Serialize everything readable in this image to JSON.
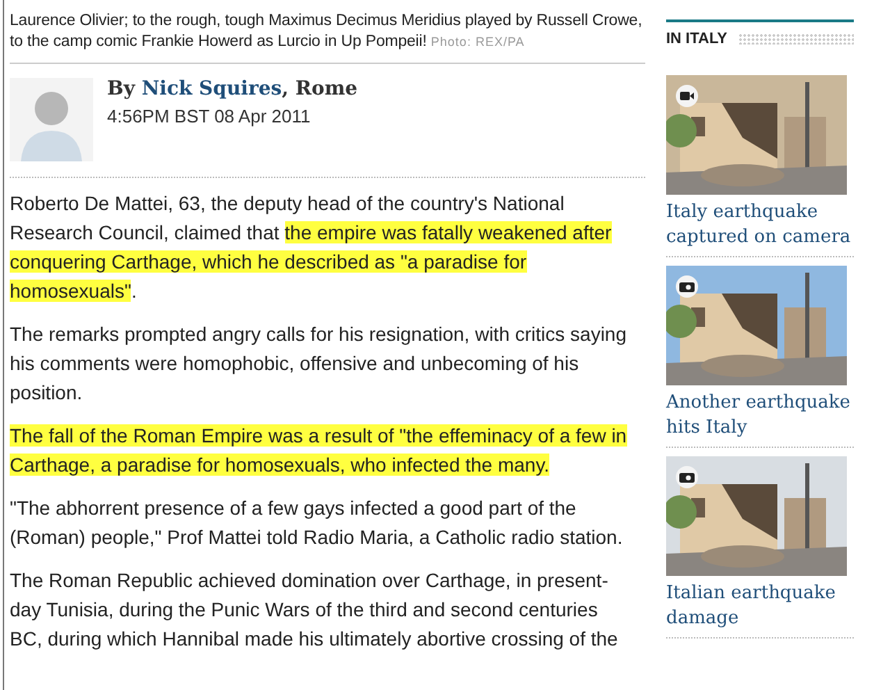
{
  "caption": {
    "text": "Laurence Olivier; to the rough, tough Maximus Decimus Meridius played by Russell Crowe, to the camp comic Frankie Howerd as Lurcio in Up Pompeii!",
    "credit": "Photo: REX/PA"
  },
  "byline": {
    "prefix": "By",
    "author": "Nick Squires",
    "place": ", Rome",
    "date": "4:56PM BST 08 Apr 2011"
  },
  "paragraphs": [
    {
      "segments": [
        {
          "text": "Roberto De Mattei, 63, the deputy head of the country's National Research Council, claimed that ",
          "highlighted": false
        },
        {
          "text": "the empire was fatally weakened after conquering Carthage, which he described as \"a paradise for homosexuals\"",
          "highlighted": true
        },
        {
          "text": ".",
          "highlighted": false
        }
      ]
    },
    {
      "segments": [
        {
          "text": "The remarks prompted angry calls for his resignation, with critics saying his comments were homophobic, offensive and unbecoming of his position.",
          "highlighted": false
        }
      ]
    },
    {
      "segments": [
        {
          "text": "The fall of the Roman Empire was a result of \"the effeminacy of a few in Carthage, a paradise for homosexuals, who infected the many.",
          "highlighted": true
        }
      ]
    },
    {
      "segments": [
        {
          "text": "\"The abhorrent presence of a few gays infected a good part of the (Roman) people,\" Prof Mattei told Radio Maria, a Catholic radio station.",
          "highlighted": false
        }
      ]
    },
    {
      "segments": [
        {
          "text": "The Roman Republic achieved domination over Carthage, in present-day Tunisia, during the Punic Wars of the third and second centuries BC, during which Hannibal made his ultimately abortive crossing of the",
          "highlighted": false
        }
      ]
    }
  ],
  "sidebar": {
    "title": "IN ITALY",
    "items": [
      {
        "kind": "video",
        "headline": "Italy earthquake captured on camera"
      },
      {
        "headline": "Another earthquake hits Italy"
      },
      {
        "headline": "Italian earthquake damage"
      }
    ]
  }
}
